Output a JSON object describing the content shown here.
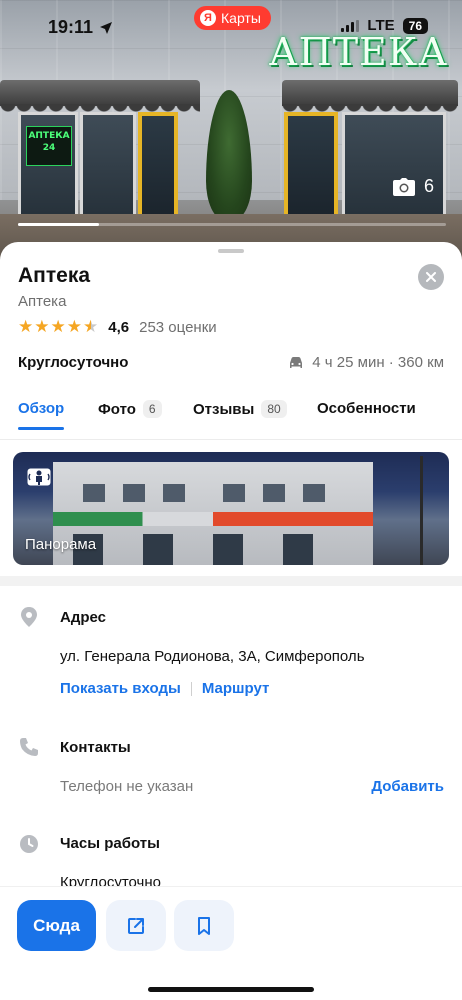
{
  "status_bar": {
    "time": "19:11",
    "app_pill": "Карты",
    "app_pill_logo": "Я",
    "network": "LTE",
    "battery": "76"
  },
  "hero": {
    "sign_text": "АПТЕКА",
    "neon_text": "АПТЕКА 24",
    "photo_count": "6",
    "gallery_progress": 0.19
  },
  "place": {
    "title": "Аптека",
    "category": "Аптека",
    "rating_value": "4,6",
    "rating_stars": 4.6,
    "rating_count": "253 оценки",
    "hours_short": "Круглосуточно",
    "route": "4 ч 25 мин · 360 км"
  },
  "tabs": [
    {
      "label": "Обзор",
      "badge": ""
    },
    {
      "label": "Фото",
      "badge": "6"
    },
    {
      "label": "Отзывы",
      "badge": "80"
    },
    {
      "label": "Особенности",
      "badge": ""
    }
  ],
  "panorama": {
    "label": "Панорама"
  },
  "address": {
    "title": "Адрес",
    "value": "ул. Генерала Родионова, 3А, Симферополь",
    "show_entrances": "Показать входы",
    "route": "Маршрут"
  },
  "contacts": {
    "title": "Контакты",
    "phone": "Телефон не указан",
    "add": "Добавить"
  },
  "hours": {
    "title": "Часы работы",
    "value": "Круглосуточно"
  },
  "actions": {
    "go": "Сюда"
  },
  "icons": {
    "camera": "camera-icon",
    "close": "close-icon",
    "car": "car-icon",
    "panorama": "panorama-icon",
    "pin": "location-pin-icon",
    "phone": "phone-icon",
    "clock": "clock-icon",
    "share": "share-icon",
    "bookmark": "bookmark-icon",
    "location_arrow": "location-arrow-icon"
  },
  "colors": {
    "accent": "#1a73e8",
    "star": "#f5a623",
    "app_pill": "#ff3b30"
  }
}
